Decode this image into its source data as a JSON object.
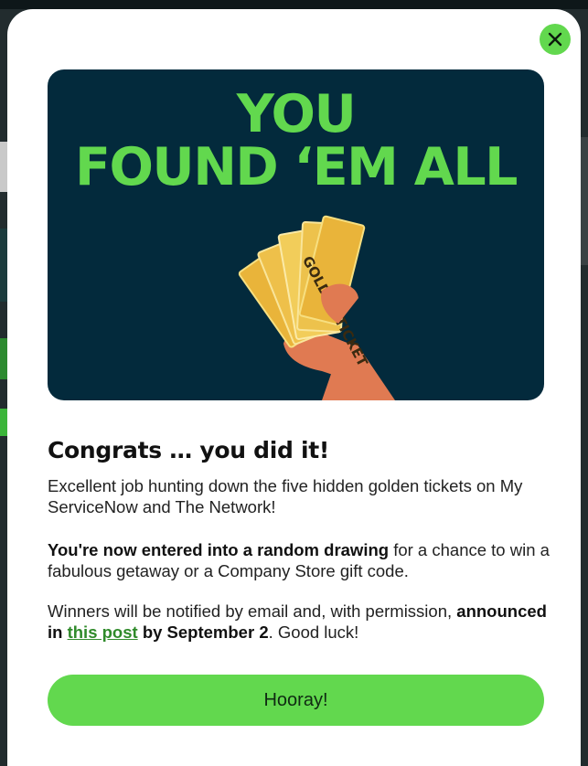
{
  "modal": {
    "close_label": "×",
    "hero": {
      "title_line1": "YOU",
      "title_line2": "FOUND ‘EM ALL",
      "ticket_text": "GOLDEN TICKET"
    },
    "heading": "Congrats … you did it!",
    "paragraph1": "Excellent job hunting down the five hidden golden tickets on My ServiceNow and The Network!",
    "paragraph2_bold": "You're now entered into a random drawing",
    "paragraph2_rest": " for a chance to win a fabulous getaway or a Company Store gift code.",
    "paragraph3_start": "Winners will be notified by email and, with permission, ",
    "paragraph3_bold1": "announced in ",
    "paragraph3_link": "this post",
    "paragraph3_bold2": " by September 2",
    "paragraph3_end": ". Good luck!",
    "button_label": "Hooray!"
  },
  "colors": {
    "accent": "#62d84e",
    "hero_bg": "#032a3c",
    "link": "#2f8a2a"
  }
}
